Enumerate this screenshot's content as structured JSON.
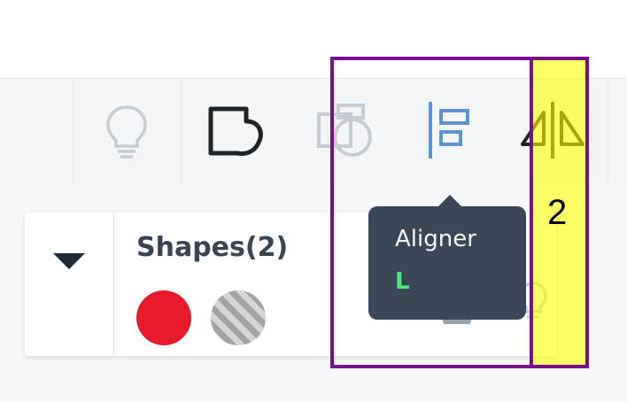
{
  "toolbar": {
    "tools": [
      {
        "icon": "lightbulb-icon",
        "state": "disabled"
      },
      {
        "icon": "path-shape-icon",
        "state": "active"
      },
      {
        "icon": "boolean-shape-icon",
        "state": "disabled"
      },
      {
        "icon": "align-left-icon",
        "state": "enabled"
      },
      {
        "icon": "flip-horizontal-icon",
        "state": "enabled"
      }
    ]
  },
  "tooltip": {
    "title": "Aligner",
    "shortcut": "L"
  },
  "layer_card": {
    "name": "Shapes(2)",
    "swatches": [
      "#e8192c",
      "hatched-gray"
    ],
    "icons": [
      "lock-open-icon",
      "lightbulb-icon"
    ]
  },
  "annotation": {
    "label": "2"
  },
  "colors": {
    "highlight_border": "#7a0f8e",
    "highlight_fill": "#ffff00",
    "tooltip_bg": "#3b4757",
    "shortcut": "#4fe87a",
    "accent_blue": "#5b93d4",
    "swatch_red": "#e8192c"
  }
}
